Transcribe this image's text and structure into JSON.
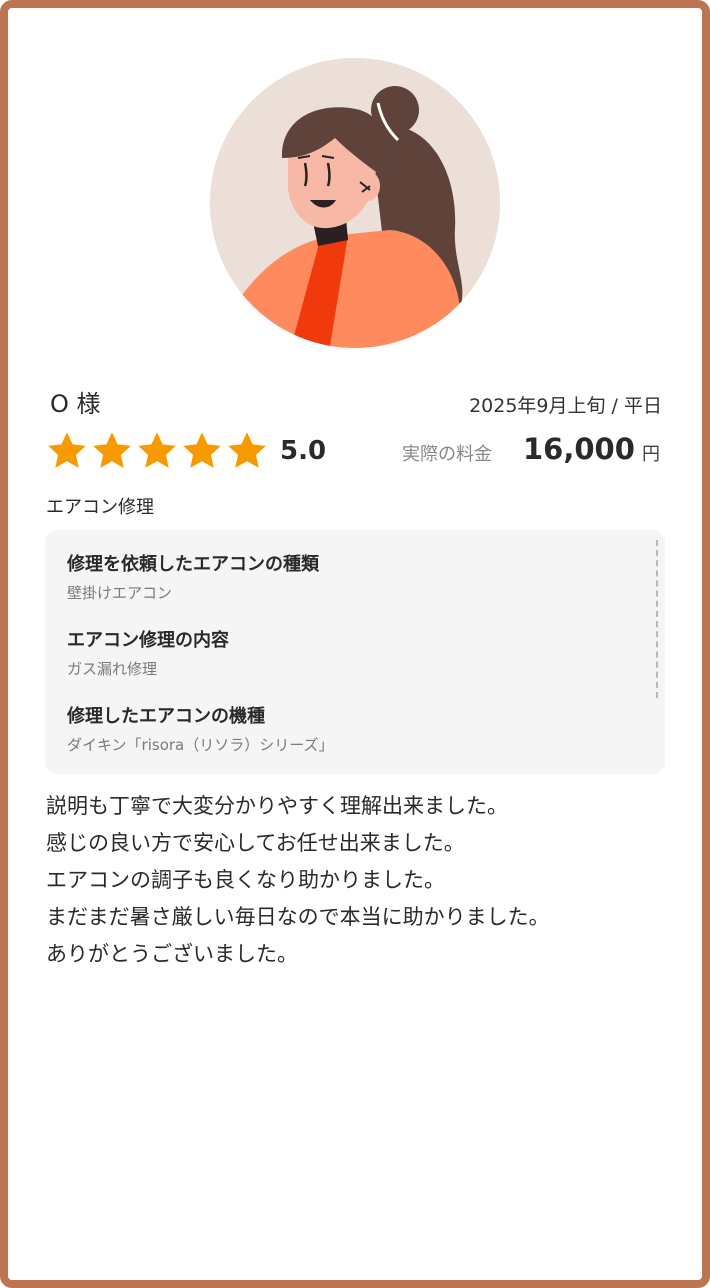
{
  "review": {
    "customer_name": "O 様",
    "date": "2025年9月上旬 / 平日",
    "rating": {
      "value": 5.0,
      "max": 5,
      "label": "5.0"
    },
    "price": {
      "label": "実際の料金",
      "value": "16,000",
      "unit": "円"
    },
    "category": "エアコン修理",
    "details": [
      {
        "question": "修理を依頼したエアコンの種類",
        "answer": "壁掛けエアコン"
      },
      {
        "question": "エアコン修理の内容",
        "answer": "ガス漏れ修理"
      },
      {
        "question": "修理したエアコンの機種",
        "answer": "ダイキン「risora（リソラ）シリーズ」"
      }
    ],
    "comment_lines": [
      "説明も丁寧で大変分かりやすく理解出来ました。",
      "感じの良い方で安心してお任せ出来ました。",
      "エアコンの調子も良くなり助かりました。",
      "まだまだ暑さ厳しい毎日なので本当に助かりました。",
      "ありがとうございました。"
    ]
  },
  "colors": {
    "border": "#bd7450",
    "star": "#f79a00",
    "avatar_bg": "#ecdfd8",
    "panel_bg": "#f5f5f5"
  },
  "icons": {
    "avatar": "woman-avatar-illustration",
    "star": "star-icon"
  }
}
